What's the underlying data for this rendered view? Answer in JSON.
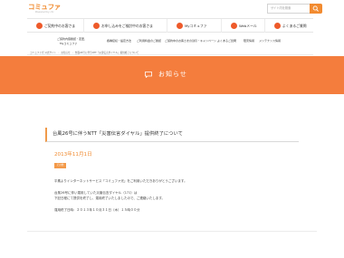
{
  "header": {
    "logo_text": "コミュファ",
    "logo_subtext": "Powered by ctc",
    "search_placeholder": "サイト内を検索",
    "search_icon": "magnifier-icon",
    "accent_color": "#f28b30"
  },
  "nav_top": [
    {
      "label": "ご契約中のお客さま",
      "icon": "person-icon"
    },
    {
      "label": "お申し込みをご検討中のお客さま",
      "icon": "document-icon"
    },
    {
      "label": "Myコミュファ",
      "icon": "my-icon"
    },
    {
      "label": "Webメール",
      "icon": "mail-icon"
    },
    {
      "label": "よくあるご質問",
      "icon": "question-icon"
    }
  ],
  "nav_sub": [
    {
      "label": "ご契約内容確認・変更、"
    },
    {
      "label": "Myコミュファ"
    },
    {
      "label": "各種接続・設定方法"
    },
    {
      "label": "ご利用料金のご確認"
    },
    {
      "label": "ご契約中のお客さまの割引・キャンペーン"
    },
    {
      "label": "よくあるご質問"
    },
    {
      "label": "障害情報"
    },
    {
      "label": "メンテナンス情報"
    }
  ],
  "breadcrumb": [
    {
      "label": "コミュファ光 公式サイト"
    },
    {
      "label": "お知らせ"
    },
    {
      "label": "台風26号に伴うNTT「災害伝言ダイヤル」提供終了について"
    }
  ],
  "banner": {
    "title": "お知らせ",
    "icon": "speech-bubble-icon",
    "color": "#f47d3d"
  },
  "article": {
    "title": "台風26号に伴うNTT「災害伝言ダイヤル」提供終了について",
    "date": "2013年11月1日",
    "tag": "その他",
    "body": [
      "平素よりインターネットサービス「コミュファ光」をご利用いただきありがとうございます。",
      "台風26号に伴い運用していた災害伝言ダイヤル（171）は",
      "下記日程にて提供を終了し、運用終了いたしましたので、ご連絡いたします。",
      "運用終了日時：２０１３年１０月３１日（木）１５時００分"
    ]
  }
}
